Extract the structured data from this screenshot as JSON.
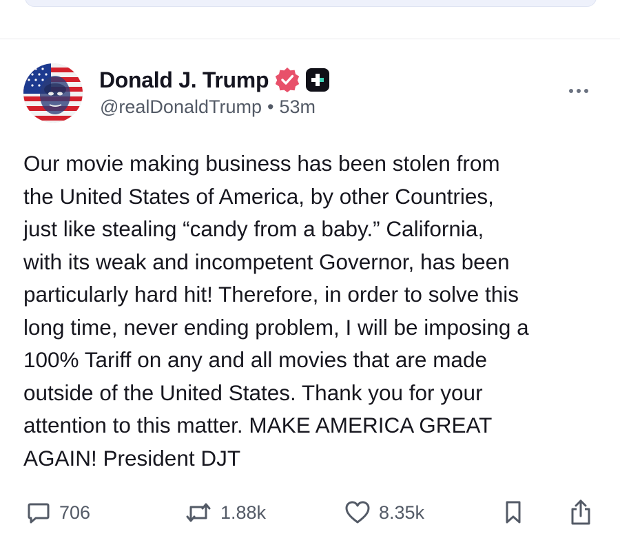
{
  "post": {
    "author": {
      "display_name": "Donald J. Trump",
      "handle": "@realDonaldTrump",
      "verified_icon": "verified-badge-icon",
      "plus_icon": "plus-badge-icon"
    },
    "separator": "•",
    "timestamp": "53m",
    "text": "Our movie making business has been stolen from\nthe United States of America, by other Countries,\njust like stealing “candy from a baby.” California,\nwith its weak and incompetent Governor, has been\nparticularly hard hit! Therefore, in order to solve this\nlong time, never ending problem, I will be imposing a\n100% Tariff on any and all movies that are made\noutside of the United States. Thank you for your\nattention to this matter. MAKE AMERICA GREAT\nAGAIN! President DJT",
    "actions": {
      "replies": "706",
      "reposts": "1.88k",
      "likes": "8.35k"
    }
  },
  "colors": {
    "verified": "#e8506a",
    "text": "#17171f",
    "muted": "#535a66"
  }
}
